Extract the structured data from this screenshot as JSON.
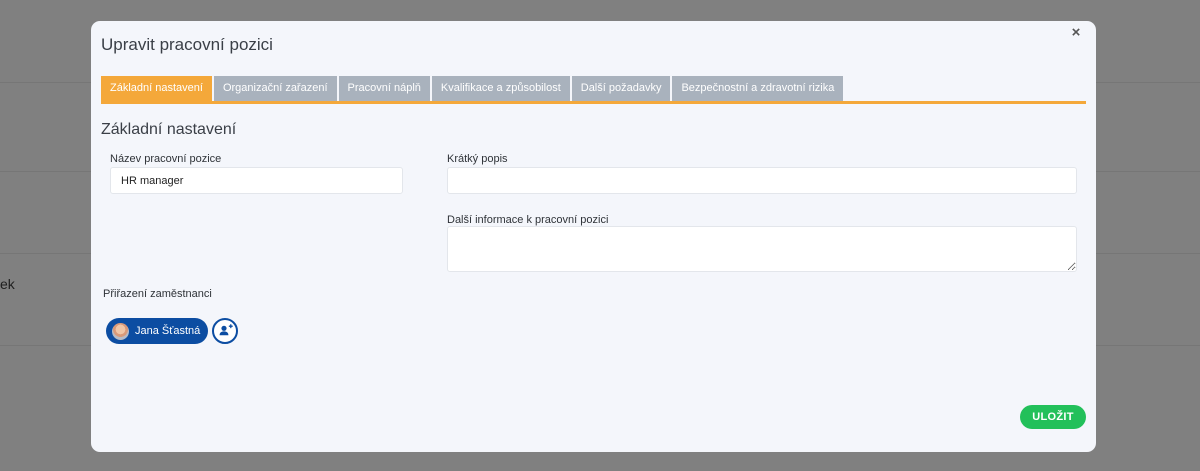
{
  "background": {
    "partial_text": "ek"
  },
  "modal": {
    "title": "Upravit pracovní pozici",
    "close_glyph": "×"
  },
  "tabs": [
    {
      "label": "Základní nastavení",
      "active": true
    },
    {
      "label": "Organizační zařazení",
      "active": false
    },
    {
      "label": "Pracovní náplň",
      "active": false
    },
    {
      "label": "Kvalifikace a způsobilost",
      "active": false
    },
    {
      "label": "Další požadavky",
      "active": false
    },
    {
      "label": "Bezpečnostní a zdravotní rizika",
      "active": false
    }
  ],
  "section": {
    "title": "Základní nastavení"
  },
  "form": {
    "position_name": {
      "label": "Název pracovní pozice",
      "value": "HR manager"
    },
    "short_description": {
      "label": "Krátký popis",
      "value": ""
    },
    "additional_info": {
      "label": "Další informace k pracovní pozici",
      "value": ""
    }
  },
  "assignment": {
    "label": "Přiřazení zaměstnanci",
    "employees": [
      {
        "name": "Jana Šťastná"
      }
    ]
  },
  "actions": {
    "save_label": "ULOŽIT"
  },
  "colors": {
    "accent": "#f4a83a",
    "primary": "#0c4da2",
    "success": "#22c05a",
    "tab_inactive": "#a9b2bd"
  },
  "icons": [
    "close-icon",
    "avatar",
    "add-user-icon"
  ]
}
